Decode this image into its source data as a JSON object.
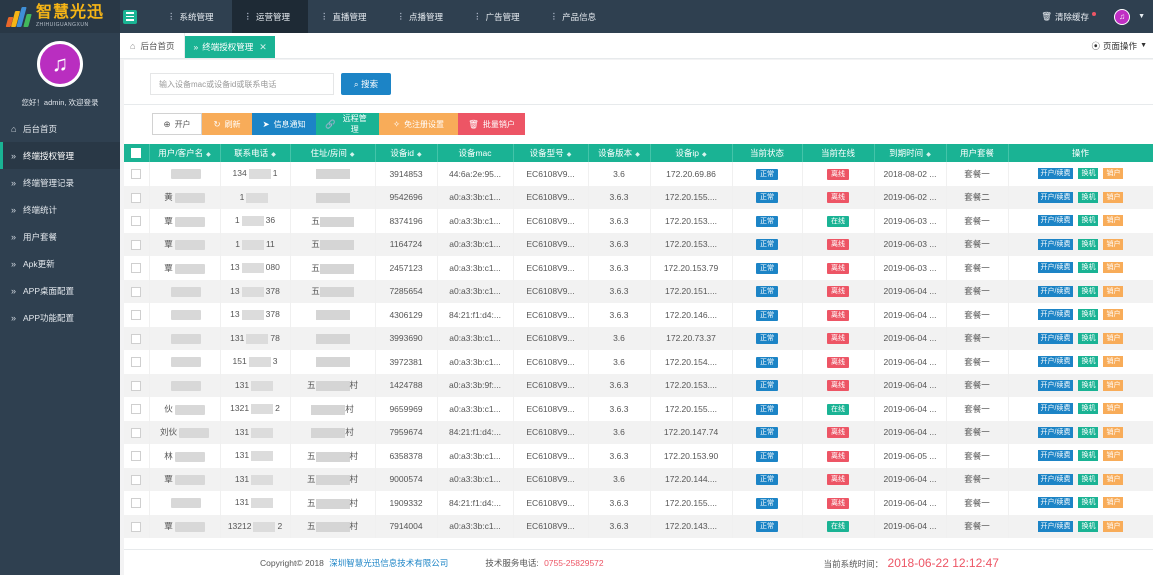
{
  "app": {
    "logo_cn": "智慧光迅",
    "logo_en": "ZHIHUIGUANGXUN",
    "logo_colors": [
      "#f6b516",
      "#e9672a",
      "#3f8fd6",
      "#42b85b"
    ]
  },
  "topnav": {
    "items": [
      {
        "label": "系统管理",
        "active": false
      },
      {
        "label": "运营管理",
        "active": true
      },
      {
        "label": "直播管理",
        "active": false
      },
      {
        "label": "点播管理",
        "active": false
      },
      {
        "label": "广告管理",
        "active": false
      },
      {
        "label": "产品信息",
        "active": false
      }
    ],
    "clear_cache": "清除缓存"
  },
  "sidebar": {
    "welcome": "您好！admin, 欢迎登录",
    "items": [
      {
        "label": "后台首页",
        "icon": "home-icon",
        "active": false
      },
      {
        "label": "终端授权管理",
        "icon": "double-chevron-icon",
        "active": true
      },
      {
        "label": "终端管理记录",
        "icon": "double-chevron-icon",
        "active": false
      },
      {
        "label": "终端统计",
        "icon": "double-chevron-icon",
        "active": false
      },
      {
        "label": "用户套餐",
        "icon": "double-chevron-icon",
        "active": false
      },
      {
        "label": "Apk更新",
        "icon": "double-chevron-icon",
        "active": false
      },
      {
        "label": "APP桌面配置",
        "icon": "double-chevron-icon",
        "active": false
      },
      {
        "label": "APP功能配置",
        "icon": "double-chevron-icon",
        "active": false
      }
    ]
  },
  "tabs": {
    "home": "后台首页",
    "active": "终端授权管理",
    "page_ops": "页面操作"
  },
  "search": {
    "placeholder": "输入设备mac或设备id或联系电话",
    "button": "搜索"
  },
  "toolbar": {
    "open": "开户",
    "refresh": "刷新",
    "notify": "信息通知",
    "remote": "远程管理",
    "free_register": "免注册设置",
    "batch_cancel": "批量销户"
  },
  "table": {
    "columns": [
      "用户/客户名",
      "联系电话",
      "住址/房间",
      "设备id",
      "设备mac",
      "设备型号",
      "设备版本",
      "设备ip",
      "当前状态",
      "当前在线",
      "到期时间",
      "用户套餐",
      "操作"
    ],
    "sortable": [
      true,
      true,
      true,
      true,
      false,
      true,
      true,
      true,
      false,
      false,
      true,
      false,
      false
    ],
    "op_labels": {
      "renew": "开户/续费",
      "swap": "换机",
      "cancel": "销户"
    },
    "rows": [
      {
        "name": "",
        "phone_a": "134",
        "phone_b": "1",
        "addr_a": "",
        "addr_b": "",
        "id": "3914853",
        "mac": "44:6a:2e:95...",
        "model": "EC6108V9...",
        "ver": "3.6",
        "ip": "172.20.69.86",
        "status": "正常",
        "online": "离线",
        "expire": "2018-08-02 ...",
        "plan": "套餐一"
      },
      {
        "name": "黄",
        "phone_a": "1",
        "phone_b": "",
        "addr_a": "",
        "addr_b": "",
        "id": "9542696",
        "mac": "a0:a3:3b:c1...",
        "model": "EC6108V9...",
        "ver": "3.6.3",
        "ip": "172.20.155....",
        "status": "正常",
        "online": "离线",
        "expire": "2019-06-02 ...",
        "plan": "套餐二"
      },
      {
        "name": "覃",
        "phone_a": "1",
        "phone_b": "36",
        "addr_a": "五",
        "addr_b": "",
        "id": "8374196",
        "mac": "a0:a3:3b:c1...",
        "model": "EC6108V9...",
        "ver": "3.6.3",
        "ip": "172.20.153....",
        "status": "正常",
        "online": "在线",
        "expire": "2019-06-03 ...",
        "plan": "套餐一"
      },
      {
        "name": "覃",
        "phone_a": "1",
        "phone_b": "11",
        "addr_a": "五",
        "addr_b": "",
        "id": "1164724",
        "mac": "a0:a3:3b:c1...",
        "model": "EC6108V9...",
        "ver": "3.6.3",
        "ip": "172.20.153....",
        "status": "正常",
        "online": "离线",
        "expire": "2019-06-03 ...",
        "plan": "套餐一"
      },
      {
        "name": "覃",
        "phone_a": "13",
        "phone_b": "080",
        "addr_a": "五",
        "addr_b": "",
        "id": "2457123",
        "mac": "a0:a3:3b:c1...",
        "model": "EC6108V9...",
        "ver": "3.6.3",
        "ip": "172.20.153.79",
        "status": "正常",
        "online": "离线",
        "expire": "2019-06-03 ...",
        "plan": "套餐一"
      },
      {
        "name": "",
        "phone_a": "13",
        "phone_b": "378",
        "addr_a": "五",
        "addr_b": "",
        "id": "7285654",
        "mac": "a0:a3:3b:c1...",
        "model": "EC6108V9...",
        "ver": "3.6.3",
        "ip": "172.20.151....",
        "status": "正常",
        "online": "离线",
        "expire": "2019-06-04 ...",
        "plan": "套餐一"
      },
      {
        "name": "",
        "phone_a": "13",
        "phone_b": "378",
        "addr_a": "",
        "addr_b": "",
        "id": "4306129",
        "mac": "84:21:f1:d4:...",
        "model": "EC6108V9...",
        "ver": "3.6.3",
        "ip": "172.20.146....",
        "status": "正常",
        "online": "离线",
        "expire": "2019-06-04 ...",
        "plan": "套餐一"
      },
      {
        "name": "",
        "phone_a": "131",
        "phone_b": "78",
        "addr_a": "",
        "addr_b": "",
        "id": "3993690",
        "mac": "a0:a3:3b:c1...",
        "model": "EC6108V9...",
        "ver": "3.6",
        "ip": "172.20.73.37",
        "status": "正常",
        "online": "离线",
        "expire": "2019-06-04 ...",
        "plan": "套餐一"
      },
      {
        "name": "",
        "phone_a": "151",
        "phone_b": "3",
        "addr_a": "",
        "addr_b": "",
        "id": "3972381",
        "mac": "a0:a3:3b:c1...",
        "model": "EC6108V9...",
        "ver": "3.6",
        "ip": "172.20.154....",
        "status": "正常",
        "online": "离线",
        "expire": "2019-06-04 ...",
        "plan": "套餐一"
      },
      {
        "name": "",
        "phone_a": "131",
        "phone_b": "",
        "addr_a": "五",
        "addr_b": "村",
        "id": "1424788",
        "mac": "a0:a3:3b:9f:...",
        "model": "EC6108V9...",
        "ver": "3.6.3",
        "ip": "172.20.153....",
        "status": "正常",
        "online": "离线",
        "expire": "2019-06-04 ...",
        "plan": "套餐一"
      },
      {
        "name": "伙",
        "phone_a": "1321",
        "phone_b": "2",
        "addr_a": "",
        "addr_b": "村",
        "id": "9659969",
        "mac": "a0:a3:3b:c1...",
        "model": "EC6108V9...",
        "ver": "3.6.3",
        "ip": "172.20.155....",
        "status": "正常",
        "online": "在线",
        "expire": "2019-06-04 ...",
        "plan": "套餐一"
      },
      {
        "name": "刘伙",
        "phone_a": "131",
        "phone_b": "",
        "addr_a": "",
        "addr_b": "村",
        "id": "7959674",
        "mac": "84:21:f1:d4:...",
        "model": "EC6108V9...",
        "ver": "3.6",
        "ip": "172.20.147.74",
        "status": "正常",
        "online": "离线",
        "expire": "2019-06-04 ...",
        "plan": "套餐一"
      },
      {
        "name": "林",
        "phone_a": "131",
        "phone_b": "",
        "addr_a": "五",
        "addr_b": "村",
        "id": "6358378",
        "mac": "a0:a3:3b:c1...",
        "model": "EC6108V9...",
        "ver": "3.6.3",
        "ip": "172.20.153.90",
        "status": "正常",
        "online": "离线",
        "expire": "2019-06-05 ...",
        "plan": "套餐一"
      },
      {
        "name": "覃",
        "phone_a": "131",
        "phone_b": "",
        "addr_a": "五",
        "addr_b": "村",
        "id": "9000574",
        "mac": "a0:a3:3b:c1...",
        "model": "EC6108V9...",
        "ver": "3.6",
        "ip": "172.20.144....",
        "status": "正常",
        "online": "离线",
        "expire": "2019-06-04 ...",
        "plan": "套餐一"
      },
      {
        "name": "",
        "phone_a": "131",
        "phone_b": "",
        "addr_a": "五",
        "addr_b": "村",
        "id": "1909332",
        "mac": "84:21:f1:d4:...",
        "model": "EC6108V9...",
        "ver": "3.6.3",
        "ip": "172.20.155....",
        "status": "正常",
        "online": "离线",
        "expire": "2019-06-04 ...",
        "plan": "套餐一"
      },
      {
        "name": "覃",
        "phone_a": "13212",
        "phone_b": "2",
        "addr_a": "五",
        "addr_b": "村",
        "id": "7914004",
        "mac": "a0:a3:3b:c1...",
        "model": "EC6108V9...",
        "ver": "3.6.3",
        "ip": "172.20.143....",
        "status": "正常",
        "online": "在线",
        "expire": "2019-06-04 ...",
        "plan": "套餐一"
      }
    ]
  },
  "footer": {
    "copyright": "Copyright© 2018",
    "company": "深圳智慧光迅信息技术有限公司",
    "service_label": "技术服务电话:",
    "service_tel": "0755-25829572",
    "time_label": "当前系统时间：",
    "time_value": "2018-06-22 12:12:47"
  },
  "colors": {
    "sidebar": "#2f4050",
    "accent": "#1ab394",
    "primary": "#1c84c6",
    "warning": "#f8ac59",
    "danger": "#ed5565"
  }
}
